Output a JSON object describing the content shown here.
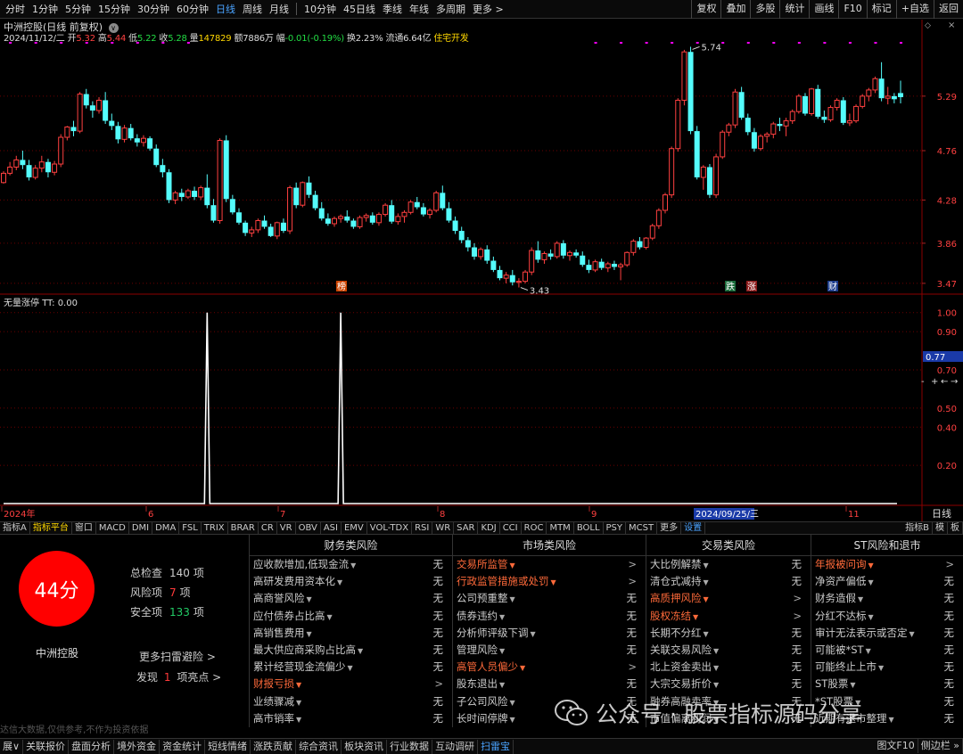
{
  "toolbar": {
    "periods": [
      "分时",
      "1分钟",
      "5分钟",
      "15分钟",
      "30分钟",
      "60分钟",
      "日线",
      "周线",
      "月线",
      "10分钟",
      "45日线",
      "季线",
      "年线",
      "多周期",
      "更多 >"
    ],
    "active_period": "日线",
    "tools": [
      "复权",
      "叠加",
      "多股",
      "统计",
      "画线",
      "F10",
      "标记",
      "+自选",
      "返回"
    ]
  },
  "quote": {
    "title": "中洲控股(日线 前复权)",
    "date": "2024/11/12/二",
    "open_label": "开",
    "open": "5.32",
    "high_label": "高",
    "high": "5.44",
    "low_label": "低",
    "low": "5.22",
    "close_label": "收",
    "close": "5.28",
    "vol_label": "量",
    "volume": "147829",
    "amount_label": "额",
    "amount": "7886万",
    "chg_label": "幅",
    "change": "-0.01(-0.19%)",
    "turn_label": "换",
    "turnover": "2.23%",
    "float_label": "流通",
    "float_cap": "6.64亿",
    "concept": "住宅开发"
  },
  "chart_data": [
    {
      "type": "candlestick",
      "price_axis": {
        "ticks": [
          5.29,
          4.76,
          4.28,
          3.86,
          3.47
        ]
      },
      "max_label": "5.74",
      "min_label": "3.43",
      "x_axis_labels": [
        "2024年",
        "6",
        "7",
        "8",
        "9",
        "2024/09/25/三",
        "11"
      ],
      "x_right_label": "日线",
      "markers": [
        "榜",
        "跌",
        "涨",
        "财"
      ],
      "candles": [
        [
          4.45,
          4.56,
          4.44,
          4.54
        ],
        [
          4.54,
          4.65,
          4.52,
          4.6
        ],
        [
          4.6,
          4.71,
          4.57,
          4.67
        ],
        [
          4.67,
          4.76,
          4.58,
          4.62
        ],
        [
          4.62,
          4.67,
          4.47,
          4.5
        ],
        [
          4.5,
          4.62,
          4.48,
          4.59
        ],
        [
          4.59,
          4.71,
          4.55,
          4.65
        ],
        [
          4.65,
          4.68,
          4.5,
          4.55
        ],
        [
          4.55,
          4.66,
          4.52,
          4.63
        ],
        [
          4.63,
          4.92,
          4.6,
          4.89
        ],
        [
          4.89,
          5.0,
          4.86,
          4.99
        ],
        [
          4.99,
          5.05,
          4.9,
          4.95
        ],
        [
          4.95,
          5.33,
          4.93,
          5.31
        ],
        [
          5.31,
          5.36,
          5.17,
          5.2
        ],
        [
          5.2,
          5.24,
          5.08,
          5.15
        ],
        [
          5.15,
          5.28,
          5.12,
          5.25
        ],
        [
          5.25,
          5.33,
          5.02,
          5.05
        ],
        [
          5.05,
          5.12,
          4.96,
          5.0
        ],
        [
          5.0,
          5.04,
          4.83,
          4.87
        ],
        [
          4.87,
          5.01,
          4.84,
          4.98
        ],
        [
          4.98,
          5.02,
          4.86,
          4.88
        ],
        [
          4.88,
          4.92,
          4.8,
          4.84
        ],
        [
          4.84,
          4.91,
          4.8,
          4.88
        ],
        [
          4.88,
          4.9,
          4.76,
          4.78
        ],
        [
          4.78,
          4.82,
          4.6,
          4.62
        ],
        [
          4.62,
          4.68,
          4.5,
          4.55
        ],
        [
          4.55,
          4.58,
          4.25,
          4.28
        ],
        [
          4.28,
          4.37,
          4.24,
          4.35
        ],
        [
          4.35,
          4.39,
          4.27,
          4.31
        ],
        [
          4.31,
          4.39,
          4.29,
          4.37
        ],
        [
          4.37,
          4.41,
          4.28,
          4.31
        ],
        [
          4.31,
          4.42,
          4.28,
          4.4
        ],
        [
          4.4,
          4.53,
          4.2,
          4.23
        ],
        [
          4.23,
          4.29,
          4.06,
          4.08
        ],
        [
          4.08,
          4.88,
          4.05,
          4.86
        ],
        [
          4.86,
          4.91,
          4.26,
          4.29
        ],
        [
          4.29,
          4.33,
          4.14,
          4.16
        ],
        [
          4.16,
          4.2,
          4.04,
          4.06
        ],
        [
          4.06,
          4.08,
          3.93,
          3.96
        ],
        [
          3.96,
          4.02,
          3.92,
          3.99
        ],
        [
          3.99,
          4.1,
          3.96,
          4.08
        ],
        [
          4.08,
          4.13,
          4.0,
          4.02
        ],
        [
          4.02,
          4.05,
          3.92,
          3.93
        ],
        [
          3.93,
          4.07,
          3.9,
          4.06
        ],
        [
          4.06,
          4.1,
          3.96,
          3.98
        ],
        [
          3.98,
          4.42,
          3.95,
          4.4
        ],
        [
          4.4,
          4.45,
          4.2,
          4.23
        ],
        [
          4.23,
          4.46,
          4.21,
          4.45
        ],
        [
          4.45,
          4.51,
          4.3,
          4.33
        ],
        [
          4.33,
          4.37,
          4.18,
          4.2
        ],
        [
          4.2,
          4.26,
          4.08,
          4.1
        ],
        [
          4.1,
          4.15,
          4.03,
          4.05
        ],
        [
          4.05,
          4.12,
          4.02,
          4.1
        ],
        [
          4.1,
          4.14,
          4.06,
          4.12
        ],
        [
          4.12,
          4.18,
          4.06,
          4.08
        ],
        [
          4.08,
          4.1,
          4.0,
          4.02
        ],
        [
          4.02,
          4.13,
          4.0,
          4.11
        ],
        [
          4.11,
          4.15,
          4.07,
          4.13
        ],
        [
          4.13,
          4.16,
          4.04,
          4.06
        ],
        [
          4.06,
          4.16,
          4.03,
          4.14
        ],
        [
          4.14,
          4.25,
          4.12,
          4.23
        ],
        [
          4.23,
          4.28,
          4.05,
          4.07
        ],
        [
          4.07,
          4.15,
          4.04,
          4.12
        ],
        [
          4.12,
          4.18,
          4.06,
          4.16
        ],
        [
          4.16,
          4.28,
          4.14,
          4.26
        ],
        [
          4.26,
          4.31,
          4.19,
          4.21
        ],
        [
          4.21,
          4.25,
          4.12,
          4.14
        ],
        [
          4.14,
          4.2,
          4.1,
          4.18
        ],
        [
          4.18,
          4.37,
          4.16,
          4.35
        ],
        [
          4.35,
          4.42,
          4.18,
          4.2
        ],
        [
          4.2,
          4.26,
          4.06,
          4.08
        ],
        [
          4.08,
          4.12,
          3.95,
          3.98
        ],
        [
          3.98,
          4.02,
          3.86,
          3.89
        ],
        [
          3.89,
          3.92,
          3.78,
          3.82
        ],
        [
          3.82,
          3.86,
          3.7,
          3.73
        ],
        [
          3.73,
          3.82,
          3.7,
          3.8
        ],
        [
          3.8,
          3.84,
          3.66,
          3.69
        ],
        [
          3.69,
          3.73,
          3.58,
          3.6
        ],
        [
          3.6,
          3.64,
          3.5,
          3.52
        ],
        [
          3.52,
          3.58,
          3.47,
          3.55
        ],
        [
          3.55,
          3.6,
          3.45,
          3.48
        ],
        [
          3.48,
          3.52,
          3.43,
          3.49
        ],
        [
          3.49,
          3.6,
          3.47,
          3.58
        ],
        [
          3.58,
          3.82,
          3.55,
          3.79
        ],
        [
          3.79,
          3.88,
          3.67,
          3.7
        ],
        [
          3.7,
          3.78,
          3.66,
          3.76
        ],
        [
          3.76,
          3.8,
          3.7,
          3.73
        ],
        [
          3.73,
          3.88,
          3.71,
          3.86
        ],
        [
          3.86,
          3.89,
          3.71,
          3.74
        ],
        [
          3.74,
          3.79,
          3.69,
          3.77
        ],
        [
          3.77,
          3.8,
          3.72,
          3.74
        ],
        [
          3.74,
          3.78,
          3.63,
          3.65
        ],
        [
          3.65,
          3.7,
          3.57,
          3.6
        ],
        [
          3.6,
          3.7,
          3.58,
          3.68
        ],
        [
          3.68,
          3.71,
          3.6,
          3.62
        ],
        [
          3.62,
          3.68,
          3.58,
          3.66
        ],
        [
          3.66,
          3.69,
          3.6,
          3.63
        ],
        [
          3.63,
          3.67,
          3.5,
          3.65
        ],
        [
          3.65,
          3.78,
          3.63,
          3.77
        ],
        [
          3.77,
          3.9,
          3.74,
          3.88
        ],
        [
          3.88,
          3.92,
          3.8,
          3.82
        ],
        [
          3.82,
          3.92,
          3.8,
          3.91
        ],
        [
          3.91,
          4.05,
          3.89,
          4.03
        ],
        [
          4.03,
          4.2,
          4.0,
          4.18
        ],
        [
          4.18,
          4.35,
          4.15,
          4.33
        ],
        [
          4.33,
          4.8,
          4.3,
          4.78
        ],
        [
          4.78,
          5.27,
          4.75,
          5.25
        ],
        [
          5.25,
          5.74,
          5.2,
          5.72
        ],
        [
          5.72,
          5.77,
          4.92,
          4.95
        ],
        [
          4.95,
          5.0,
          4.48,
          4.5
        ],
        [
          4.5,
          4.62,
          4.38,
          4.6
        ],
        [
          4.6,
          4.63,
          4.3,
          4.33
        ],
        [
          4.33,
          4.73,
          4.3,
          4.7
        ],
        [
          4.7,
          4.96,
          4.68,
          4.94
        ],
        [
          4.94,
          5.03,
          4.9,
          5.01
        ],
        [
          5.01,
          5.36,
          4.98,
          5.33
        ],
        [
          5.33,
          5.38,
          5.06,
          5.08
        ],
        [
          5.08,
          5.12,
          4.91,
          4.94
        ],
        [
          4.94,
          4.98,
          4.75,
          4.78
        ],
        [
          4.78,
          4.92,
          4.76,
          4.9
        ],
        [
          4.9,
          4.94,
          4.84,
          4.92
        ],
        [
          4.92,
          5.04,
          4.88,
          5.02
        ],
        [
          5.02,
          5.08,
          4.95,
          5.0
        ],
        [
          5.0,
          5.08,
          4.9,
          5.05
        ],
        [
          5.05,
          5.16,
          5.02,
          5.14
        ],
        [
          5.14,
          5.31,
          5.12,
          5.29
        ],
        [
          5.29,
          5.32,
          5.1,
          5.12
        ],
        [
          5.12,
          5.37,
          5.1,
          5.36
        ],
        [
          5.36,
          5.4,
          5.07,
          5.09
        ],
        [
          5.09,
          5.15,
          5.03,
          5.06
        ],
        [
          5.06,
          5.2,
          5.04,
          5.18
        ],
        [
          5.18,
          5.27,
          5.15,
          5.25
        ],
        [
          5.25,
          5.28,
          5.01,
          5.03
        ],
        [
          5.03,
          5.12,
          5.0,
          5.05
        ],
        [
          5.05,
          5.21,
          5.03,
          5.19
        ],
        [
          5.19,
          5.31,
          5.17,
          5.29
        ],
        [
          5.29,
          5.37,
          5.24,
          5.35
        ],
        [
          5.35,
          5.48,
          5.32,
          5.46
        ],
        [
          5.46,
          5.62,
          5.24,
          5.27
        ],
        [
          5.27,
          5.38,
          5.21,
          5.29
        ],
        [
          5.29,
          5.32,
          5.22,
          5.26
        ],
        [
          5.32,
          5.44,
          5.22,
          5.28
        ]
      ]
    },
    {
      "type": "line",
      "title": "无量涨停",
      "ind_label": "TT:",
      "ind_value": "0.00",
      "y_ticks": [
        1.0,
        0.9,
        0.77,
        0.7,
        0.5,
        0.4,
        0.2
      ],
      "y_marker": 0.77,
      "ylim": [
        0,
        1.05
      ],
      "spikes": [
        {
          "bar": 32,
          "value": 1.0
        },
        {
          "bar": 53,
          "value": 1.0
        }
      ]
    }
  ],
  "indicator_tabs": [
    "指标A",
    "指标平台",
    "窗口",
    "MACD",
    "DMI",
    "DMA",
    "FSL",
    "TRIX",
    "BRAR",
    "CR",
    "VR",
    "OBV",
    "ASI",
    "EMV",
    "VOL-TDX",
    "RSI",
    "WR",
    "SAR",
    "KDJ",
    "CCI",
    "ROC",
    "MTM",
    "BOLL",
    "PSY",
    "MCST",
    "更多",
    "设置"
  ],
  "indicator_tabs_right": [
    "指标B",
    "模",
    "板"
  ],
  "scan": {
    "score": "44分",
    "name": "中洲控股",
    "stats": [
      {
        "label": "总检查",
        "value": "140",
        "unit": "项",
        "color": "#cccccc"
      },
      {
        "label": "风险项",
        "value": "7",
        "unit": "项",
        "color": "#ff3a3a"
      },
      {
        "label": "安全项",
        "value": "133",
        "unit": "项",
        "color": "#22cc66"
      }
    ],
    "more_link": "更多扫雷避险 >",
    "found_label": "发现",
    "found_value": "1",
    "found_suffix": "项亮点 >",
    "disclaimer": "达信大数据,仅供参考,不作为投资依据",
    "columns": [
      {
        "title": "财务类风险",
        "rows": [
          {
            "label": "应收款增加,低现金流",
            "status": "无",
            "hl": false
          },
          {
            "label": "高研发费用资本化",
            "status": "无",
            "hl": false
          },
          {
            "label": "高商誉风险",
            "status": "无",
            "hl": false
          },
          {
            "label": "应付债券占比高",
            "status": "无",
            "hl": false
          },
          {
            "label": "高销售费用",
            "status": "无",
            "hl": false
          },
          {
            "label": "最大供应商采购占比高",
            "status": "无",
            "hl": false
          },
          {
            "label": "累计经营现金流偏少",
            "status": "无",
            "hl": false
          },
          {
            "label": "财报亏损",
            "status": ">",
            "hl": true
          },
          {
            "label": "业绩骤减",
            "status": "无",
            "hl": false
          },
          {
            "label": "高市销率",
            "status": "无",
            "hl": false
          }
        ]
      },
      {
        "title": "市场类风险",
        "rows": [
          {
            "label": "交易所监管",
            "status": ">",
            "hl": true
          },
          {
            "label": "行政监管措施或处罚",
            "status": ">",
            "hl": true
          },
          {
            "label": "公司预重整",
            "status": "无",
            "hl": false
          },
          {
            "label": "债券违约",
            "status": "无",
            "hl": false
          },
          {
            "label": "分析师评级下调",
            "status": "无",
            "hl": false
          },
          {
            "label": "管理风险",
            "status": "无",
            "hl": false
          },
          {
            "label": "高管人员偏少",
            "status": ">",
            "hl": true
          },
          {
            "label": "股东退出",
            "status": "无",
            "hl": false
          },
          {
            "label": "子公司风险",
            "status": "无",
            "hl": false
          },
          {
            "label": "长时间停牌",
            "status": "无",
            "hl": false
          }
        ]
      },
      {
        "title": "交易类风险",
        "rows": [
          {
            "label": "大比例解禁",
            "status": "无",
            "hl": false
          },
          {
            "label": "清仓式减持",
            "status": "无",
            "hl": false
          },
          {
            "label": "高质押风险",
            "status": ">",
            "hl": true
          },
          {
            "label": "股权冻结",
            "status": ">",
            "hl": true
          },
          {
            "label": "长期不分红",
            "status": "无",
            "hl": false
          },
          {
            "label": "关联交易风险",
            "status": "无",
            "hl": false
          },
          {
            "label": "北上资金卖出",
            "status": "无",
            "hl": false
          },
          {
            "label": "大宗交易折价",
            "status": "无",
            "hl": false
          },
          {
            "label": "融券高融卖率",
            "status": "无",
            "hl": false
          },
          {
            "label": "市值偏离利润",
            "status": "无",
            "hl": false
          }
        ]
      },
      {
        "title": "ST风险和退市",
        "rows": [
          {
            "label": "年报被问询",
            "status": ">",
            "hl": true
          },
          {
            "label": "净资产偏低",
            "status": "无",
            "hl": false
          },
          {
            "label": "财务造假",
            "status": "无",
            "hl": false
          },
          {
            "label": "分红不达标",
            "status": "无",
            "hl": false
          },
          {
            "label": "审计无法表示或否定",
            "status": "无",
            "hl": false
          },
          {
            "label": "可能被*ST",
            "status": "无",
            "hl": false
          },
          {
            "label": "可能终止上市",
            "status": "无",
            "hl": false
          },
          {
            "label": "ST股票",
            "status": "无",
            "hl": false
          },
          {
            "label": "*ST股票",
            "status": "无",
            "hl": false
          },
          {
            "label": "近期有退市整理",
            "status": "无",
            "hl": false
          }
        ]
      }
    ]
  },
  "bottom_tabs": [
    "展∨",
    "关联报价",
    "盘面分析",
    "境外资金",
    "资金统计",
    "短线情绪",
    "涨跌贡献",
    "综合资讯",
    "板块资讯",
    "行业数据",
    "互动调研",
    "扫雷宝"
  ],
  "bottom_active": "扫雷宝",
  "bottom_right": [
    "图文F10",
    "侧边栏 »"
  ],
  "watermark": "公众号 · 股票指标源码分享",
  "colors": {
    "up": "#ff4040",
    "down": "#54fcfc",
    "magenta": "#ff00ff",
    "price_axis": "#ff4040",
    "grid": "#6b0000"
  }
}
